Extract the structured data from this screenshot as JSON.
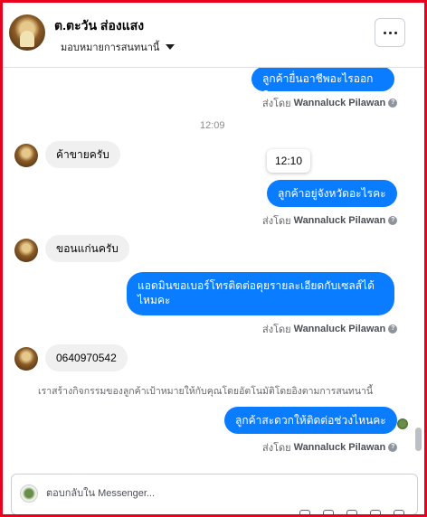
{
  "header": {
    "contact_name": "ต.ตะวัน ส่องแสง",
    "assign_label": "มอบหมายการสนทนานี้",
    "more_label": "•••"
  },
  "messages": {
    "m1_text": "ลูกค้ายื่นอาชีพอะไรออกคะ",
    "m1_sent_prefix": "ส่งโดย",
    "m1_sender": "Wannaluck Pilawan",
    "time_1209": "12:09",
    "m2_text": "ค้าขายครับ",
    "tooltip_time": "12:10",
    "m3_text": "ลูกค้าอยู่จังหวัดอะไรคะ",
    "m3_sent_prefix": "ส่งโดย",
    "m3_sender": "Wannaluck Pilawan",
    "m4_text": "ขอนแก่นครับ",
    "m5_text": "แอดมินขอเบอร์โทรติดต่อคุยรายละเอียดกับเซลส์ได้ไหมคะ",
    "m5_sent_prefix": "ส่งโดย",
    "m5_sender": "Wannaluck Pilawan",
    "m6_text": "0640970542",
    "system_note": "เราสร้างกิจกรรมของลูกค้าเป้าหมายให้กับคุณโดยอัตโนมัติโดยอิงตามการสนทนานี้",
    "m7_text": "ลูกค้าสะดวกให้ติดต่อช่วงไหนคะ",
    "m7_sent_prefix": "ส่งโดย",
    "m7_sender": "Wannaluck Pilawan"
  },
  "composer": {
    "placeholder": "ตอบกลับใน Messenger..."
  },
  "colors": {
    "outgoing_bubble": "#0a7cff",
    "incoming_bubble": "#f0f0f0",
    "frame_border": "#e8001c"
  }
}
